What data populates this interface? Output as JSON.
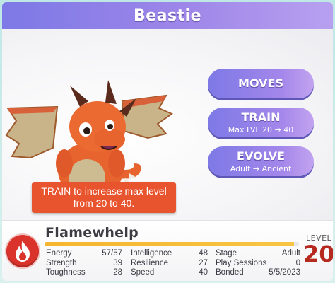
{
  "header": {
    "title": "Beastie"
  },
  "actions": {
    "moves": {
      "label": "MOVES"
    },
    "train": {
      "label": "TRAIN",
      "sub": "Max LVL 20 → 40"
    },
    "evolve": {
      "label": "EVOLVE",
      "sub": "Adult → Ancient"
    }
  },
  "hint": {
    "text": "TRAIN to increase max level from 20 to 40."
  },
  "creature": {
    "name": "Flamewhelp",
    "level_label": "LEVEL",
    "level": "20",
    "xp_progress": 0.98,
    "element_icon": "flame-icon",
    "colors": {
      "accent": "#7d79e6",
      "hint_bg": "#e8542e",
      "level": "#b5291f",
      "xp": "#f6b52f"
    }
  },
  "stats": {
    "col1": [
      {
        "label": "Energy",
        "value": "57/57"
      },
      {
        "label": "Strength",
        "value": "39"
      },
      {
        "label": "Toughness",
        "value": "28"
      }
    ],
    "col2": [
      {
        "label": "Intelligence",
        "value": "48"
      },
      {
        "label": "Resilience",
        "value": "27"
      },
      {
        "label": "Speed",
        "value": "40"
      }
    ],
    "col3": [
      {
        "label": "Stage",
        "value": "Adult"
      },
      {
        "label": "Play Sessions",
        "value": "0"
      },
      {
        "label": "Bonded",
        "value": "5/5/2023"
      }
    ]
  }
}
